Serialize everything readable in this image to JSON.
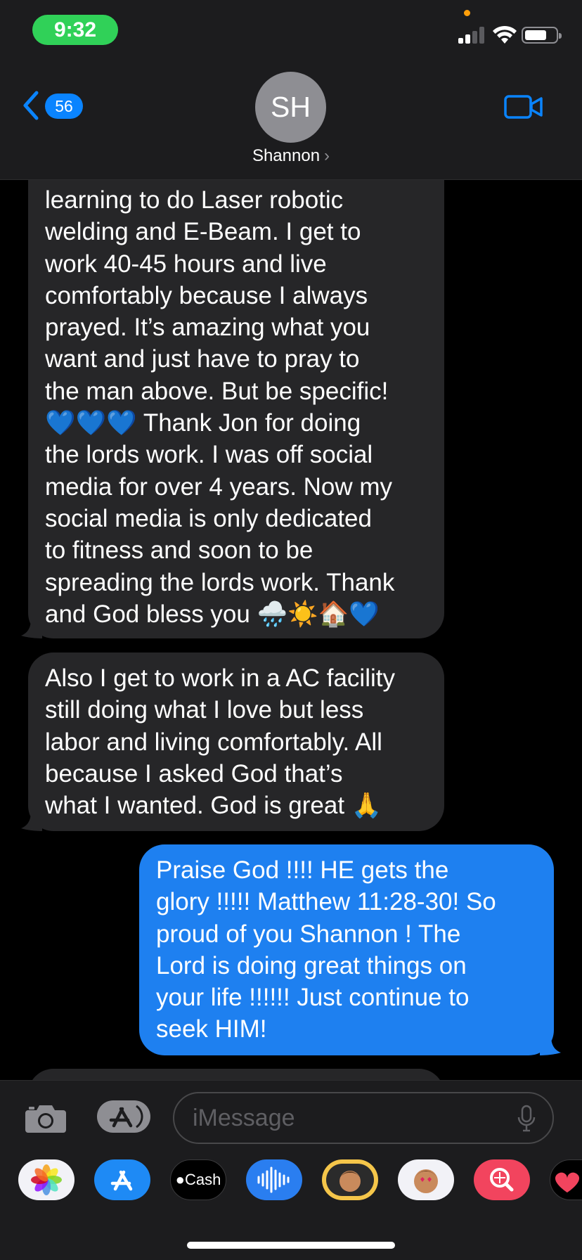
{
  "status_bar": {
    "time": "9:32",
    "colors": {
      "time_pill": "#30d158",
      "privacy_dot": "#ff9f0a"
    }
  },
  "header": {
    "back_badge": "56",
    "avatar_initials": "SH",
    "contact_name": "Shannon",
    "chevron": "›",
    "icons": [
      "chevron-left-icon",
      "video-camera-icon"
    ],
    "accent_color": "#0a84ff"
  },
  "messages": [
    {
      "direction": "incoming",
      "lines": [
        "learning to do Laser robotic",
        "welding and E-Beam. I get to",
        "work 40-45 hours and live",
        "comfortably because I always",
        "prayed. It’s amazing what you",
        "want and just have to pray to",
        "the man above. But be specific!",
        "💙💙💙 Thank Jon for doing",
        "the lords work. I was off social",
        "media for over 4 years. Now my",
        "social media is only dedicated",
        "to fitness and soon to be",
        "spreading the lords work. Thank",
        "and God bless you 🌧️☀️🏠💙"
      ]
    },
    {
      "direction": "incoming",
      "lines": [
        "Also I get to work in a AC facility",
        "still doing what I love but less",
        "labor and living comfortably. All",
        "because I asked God that’s",
        "what I wanted. God is great 🙏"
      ]
    },
    {
      "direction": "outgoing",
      "lines": [
        "Praise God !!!!  HE gets the",
        "glory !!!!! Matthew 11:28-30! So",
        "proud of you Shannon ! The",
        "Lord is doing great things on",
        "your life !!!!!! Just continue to",
        "seek HIM!"
      ]
    }
  ],
  "input_bar": {
    "placeholder": "iMessage",
    "icons": [
      "camera-icon",
      "app-store-icon",
      "microphone-icon"
    ]
  },
  "app_drawer": {
    "cash_label": "Cash",
    "apps": [
      "photos-app-icon",
      "app-store-app-icon",
      "apple-cash-app-icon",
      "audio-message-app-icon",
      "memoji-app-icon",
      "memoji-stickers-app-icon",
      "image-search-app-icon",
      "digital-touch-app-icon"
    ]
  },
  "colors": {
    "incoming_bubble": "#262628",
    "outgoing_bubble": "#1e80f0",
    "background": "#000000",
    "header": "#1c1c1e"
  }
}
